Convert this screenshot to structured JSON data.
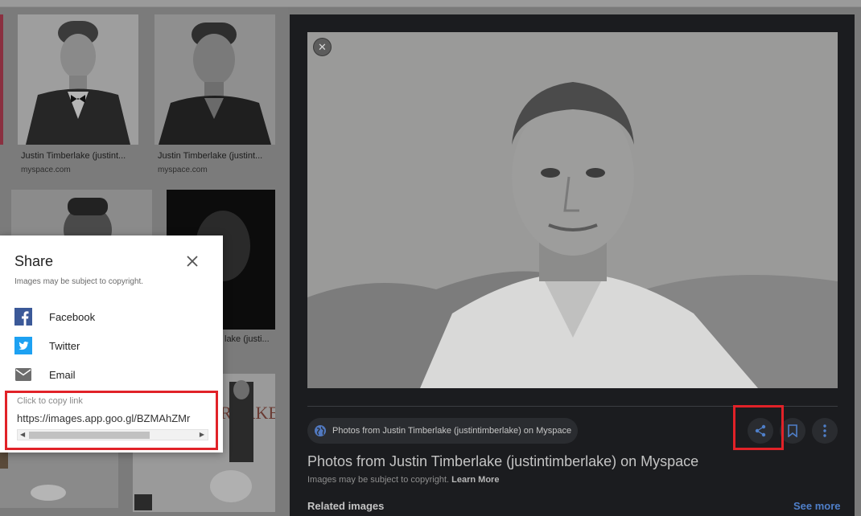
{
  "results": [
    {
      "title": "Justin Timberlake (justint...",
      "source": "myspace.com"
    },
    {
      "title": "Justin Timberlake (justint...",
      "source": "myspace.com"
    },
    {
      "title": "lake (justi..."
    }
  ],
  "preview": {
    "close_icon": "close-icon",
    "source_chip": "Photos from Justin Timberlake (justintimberlake) on Myspace",
    "title": "Photos from Justin Timberlake (justintimberlake) on Myspace",
    "copyright_text": "Images may be subject to copyright.",
    "learn_more": "Learn More",
    "related_label": "Related images",
    "see_more": "See more",
    "actions": [
      "share-icon",
      "bookmark-icon",
      "more-vert-icon"
    ]
  },
  "share_dialog": {
    "title": "Share",
    "subtitle": "Images may be subject to copyright.",
    "options": [
      {
        "label": "Facebook",
        "icon": "facebook-icon",
        "color": "#3b5998"
      },
      {
        "label": "Twitter",
        "icon": "twitter-icon",
        "color": "#1da1f2"
      },
      {
        "label": "Email",
        "icon": "email-icon",
        "color": "#6d6d6d"
      }
    ],
    "copy_label": "Click to copy link",
    "copy_link": "https://images.app.goo.gl/BZMAhZMr"
  },
  "colors": {
    "highlight": "#e12228",
    "panel": "#1b1c1f",
    "link": "#4f7fc9"
  }
}
